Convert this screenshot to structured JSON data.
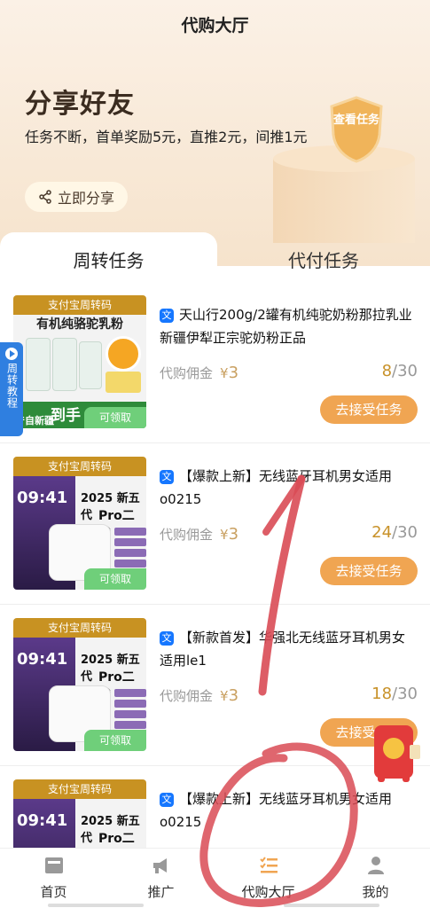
{
  "header": {
    "title": "代购大厅"
  },
  "banner": {
    "title": "分享好友",
    "desc": "任务不断，首单奖励5元，直推2元，间推1元",
    "share_label": "立即分享",
    "shield_text": "查看任务"
  },
  "tabs": [
    {
      "label": "周转任务",
      "active": true
    },
    {
      "label": "代付任务",
      "active": false
    }
  ],
  "side_tab": {
    "label": "周转教程"
  },
  "items": [
    {
      "badge": "支付宝周转码",
      "claim": "可领取",
      "platform_icon": "文",
      "name": "天山行200g/2罐有机纯驼奶粉那拉乳业新疆伊犁正宗驼奶粉正品",
      "commission_label": "代购佣金",
      "currency": "¥",
      "commission": "3",
      "count_current": "8",
      "count_total": "/30",
      "accept_label": "去接受任务",
      "thumb": {
        "kind": "milk",
        "title": "有机纯骆驼乳粉",
        "left_text": "产自新疆",
        "mid_text": "到手"
      }
    },
    {
      "badge": "支付宝周转码",
      "claim": "可领取",
      "platform_icon": "文",
      "name": "【爆款上新】无线蓝牙耳机男女适用o0215",
      "commission_label": "代购佣金",
      "currency": "¥",
      "commission": "3",
      "count_current": "24",
      "count_total": "/30",
      "accept_label": "去接受任务",
      "thumb": {
        "kind": "earbuds",
        "time": "09:41",
        "line1": "2025 新五代",
        "line2": "Pro二代"
      }
    },
    {
      "badge": "支付宝周转码",
      "claim": "可领取",
      "platform_icon": "文",
      "name": "【新款首发】华强北无线蓝牙耳机男女适用le1",
      "commission_label": "代购佣金",
      "currency": "¥",
      "commission": "3",
      "count_current": "18",
      "count_total": "/30",
      "accept_label": "去接受任务",
      "thumb": {
        "kind": "earbuds",
        "time": "09:41",
        "line1": "2025 新五代",
        "line2": "Pro二代"
      }
    },
    {
      "badge": "支付宝周转码",
      "claim": "",
      "platform_icon": "文",
      "name": "【爆款上新】无线蓝牙耳机男女适用o0215",
      "commission_label": "",
      "currency": "",
      "commission": "",
      "count_current": "",
      "count_total": "",
      "accept_label": "",
      "thumb": {
        "kind": "earbuds",
        "time": "09:41",
        "line1": "2025 新五代",
        "line2": "Pro二代"
      }
    }
  ],
  "bottom_nav": [
    {
      "label": "首页",
      "icon": "home-icon"
    },
    {
      "label": "推广",
      "icon": "megaphone-icon"
    },
    {
      "label": "代购大厅",
      "icon": "task-list-icon",
      "active": true
    },
    {
      "label": "我的",
      "icon": "person-icon"
    }
  ],
  "colors": {
    "accent": "#f0a552",
    "badge": "#c89222",
    "claim": "#6fcf7a",
    "annotation": "#d94b55"
  }
}
